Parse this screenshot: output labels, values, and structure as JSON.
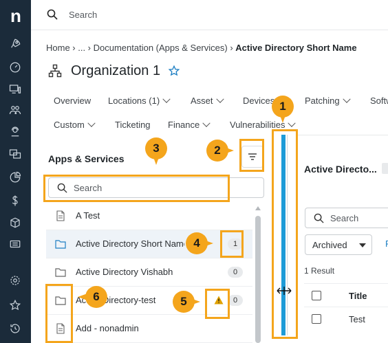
{
  "sidebar": {
    "logo": "n",
    "items": [
      {
        "icon": "rocket-icon"
      },
      {
        "icon": "dashboard-icon"
      },
      {
        "icon": "devices-icon"
      },
      {
        "icon": "users-icon"
      },
      {
        "icon": "user-support-icon"
      },
      {
        "icon": "screens-icon"
      },
      {
        "icon": "pie-chart-icon"
      },
      {
        "icon": "dollar-icon"
      },
      {
        "icon": "cube-icon"
      },
      {
        "icon": "ticket-icon"
      },
      {
        "icon": "settings-icon"
      },
      {
        "icon": "star-icon"
      },
      {
        "icon": "history-icon"
      }
    ]
  },
  "topbar": {
    "search_placeholder": "Search"
  },
  "breadcrumb": {
    "parts": "Home › ... › Documentation (Apps & Services) ›",
    "current": "Active Directory Short Name"
  },
  "org": {
    "title": "Organization 1"
  },
  "tabs_row1": [
    "Overview",
    "Locations (1)",
    "Asset",
    "Devices",
    "Patching",
    "Softw"
  ],
  "tabs_row2": [
    "Custom",
    "Ticketing",
    "Finance",
    "Vulnerabilities"
  ],
  "apps": {
    "title": "Apps & Services",
    "search_placeholder": "Search",
    "items": [
      {
        "label": "A Test",
        "type": "file",
        "count": ""
      },
      {
        "label": "Active Directory Short Name",
        "type": "folder",
        "count": "1"
      },
      {
        "label": "Active Directory Vishabh",
        "type": "folder",
        "count": "0"
      },
      {
        "label": "Active Directory-test",
        "type": "folder",
        "count": "0"
      },
      {
        "label": "Add - nonadmin",
        "type": "file",
        "count": ""
      }
    ]
  },
  "detail": {
    "title": "Active Directo...",
    "search_placeholder": "Search",
    "filter_value": "Archived",
    "result_count": "1 Result",
    "column_title": "Title",
    "rows": [
      "Test"
    ]
  },
  "callouts": [
    "1",
    "2",
    "3",
    "4",
    "5",
    "6"
  ],
  "colors": {
    "rail": "#1b2b3a",
    "highlight": "#f4a51c",
    "accent": "#1e9bd7"
  }
}
